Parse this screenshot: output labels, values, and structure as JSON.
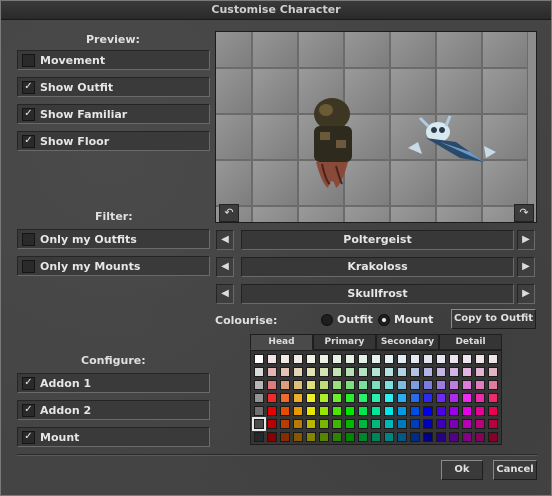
{
  "window": {
    "title": "Customise Character"
  },
  "preview": {
    "label": "Preview:",
    "options": [
      {
        "label": "Movement",
        "checked": false
      },
      {
        "label": "Show Outfit",
        "checked": true
      },
      {
        "label": "Show Familiar",
        "checked": true
      },
      {
        "label": "Show Floor",
        "checked": true
      }
    ]
  },
  "filter": {
    "label": "Filter:",
    "options": [
      {
        "label": "Only my Outfits",
        "checked": false
      },
      {
        "label": "Only my Mounts",
        "checked": false
      }
    ]
  },
  "selectors": {
    "outfit": "Poltergeist",
    "mount": "Krakoloss",
    "familiar": "Skullfrost"
  },
  "colourise": {
    "label": "Colourise:",
    "outfit_label": "Outfit",
    "mount_label": "Mount",
    "selected": "mount",
    "copy_button": "Copy to Outfit",
    "tabs": [
      "Head",
      "Primary",
      "Secondary",
      "Detail"
    ],
    "active_tab": "Head"
  },
  "configure": {
    "label": "Configure:",
    "options": [
      {
        "label": "Addon 1",
        "checked": true
      },
      {
        "label": "Addon 2",
        "checked": true
      },
      {
        "label": "Mount",
        "checked": true
      }
    ]
  },
  "footer": {
    "ok": "Ok",
    "cancel": "Cancel"
  },
  "icons": {
    "rotate_left": "rotate-left-icon",
    "rotate_right": "rotate-right-icon",
    "prev": "arrow-left-icon",
    "next": "arrow-right-icon"
  }
}
